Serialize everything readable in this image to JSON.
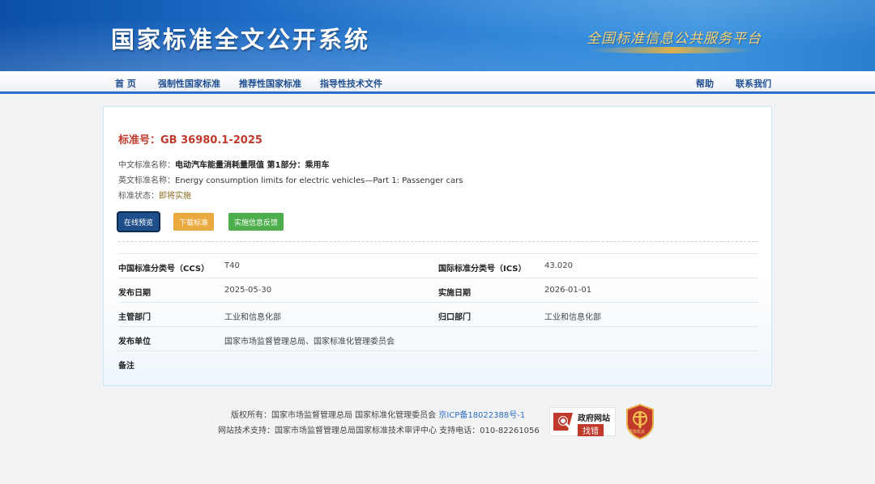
{
  "header": {
    "site_title": "国家标准全文公开系统",
    "slogan": "全国标准信息公共服务平台"
  },
  "nav": {
    "items": [
      {
        "label": "首 页"
      },
      {
        "label": "强制性国家标准"
      },
      {
        "label": "推荐性国家标准"
      },
      {
        "label": "指导性技术文件"
      }
    ],
    "right_items": [
      {
        "label": "帮助"
      },
      {
        "label": "联系我们"
      }
    ]
  },
  "standard": {
    "number_label": "标准号：",
    "number": "GB 36980.1-2025",
    "cn_name_label": "中文标准名称：",
    "cn_name": "电动汽车能量消耗量限值 第1部分：乘用车",
    "en_name_label": "英文标准名称：",
    "en_name": "Energy consumption limits for electric vehicles—Part 1: Passenger cars",
    "status_label": "标准状态：",
    "status": "即将实施"
  },
  "actions": {
    "preview": "在线预览",
    "download": "下载标准",
    "feedback": "实施信息反馈"
  },
  "details": [
    {
      "label1": "中国标准分类号（CCS）",
      "value1": "T40",
      "label2": "国际标准分类号（ICS）",
      "value2": "43.020"
    },
    {
      "label1": "发布日期",
      "value1": "2025-05-30",
      "label2": "实施日期",
      "value2": "2026-01-01"
    },
    {
      "label1": "主管部门",
      "value1": "工业和信息化部",
      "label2": "归口部门",
      "value2": "工业和信息化部"
    },
    {
      "label1": "发布单位",
      "value1": "国家市场监督管理总局、国家标准化管理委员会",
      "label2": "",
      "value2": ""
    },
    {
      "label1": "备注",
      "value1": "",
      "label2": "",
      "value2": ""
    }
  ],
  "footer": {
    "copyright": "版权所有：国家市场监督管理总局 国家标准化管理委员会",
    "icp": "京ICP备18022388号-1",
    "support": "网站技术支持：国家市场监督管理总局国家标准技术审评中心 支持电话：010-82261056",
    "gov_badge_title": "政府网站",
    "gov_badge_action": "找错",
    "party_badge_text": "党政机关"
  },
  "colors": {
    "banner": "#1d6cc6",
    "nav_text": "#1f4f93",
    "std_number": "#c0392b",
    "preview_btn": "#1f4f8a",
    "download_btn": "#eaa93f",
    "feedback_btn": "#4cae4c"
  }
}
